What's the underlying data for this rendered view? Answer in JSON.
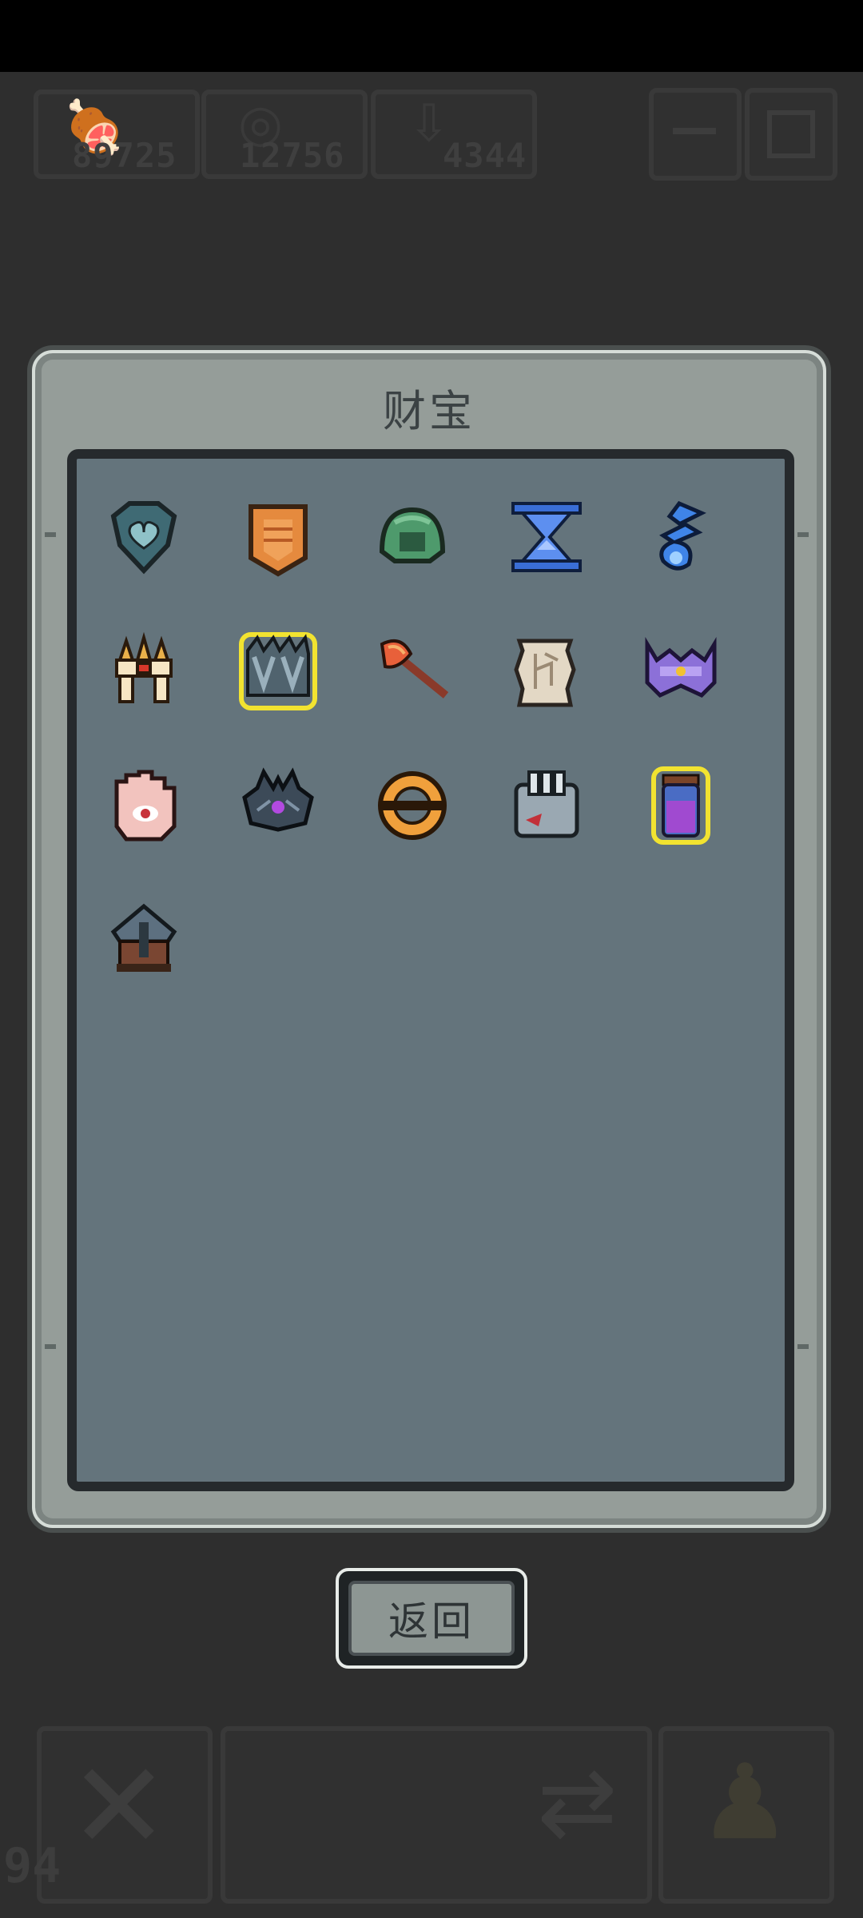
{
  "hud": {
    "resources": [
      {
        "icon": "meat-icon",
        "glyph": "🍖",
        "value": "89725"
      },
      {
        "icon": "ring-icon",
        "glyph": "◎",
        "value": "12756"
      },
      {
        "icon": "arrow-icon",
        "glyph": "⇩",
        "value": "4344"
      }
    ],
    "menu_icon": "menu-icon",
    "settings_icon": "settings-icon",
    "level": "94",
    "bottom_icons": [
      "crossed-swords-icon",
      "swap-icon",
      "character-icon"
    ]
  },
  "dialog": {
    "title": "财宝",
    "back_label": "返回"
  },
  "treasures": [
    {
      "name": "treasure-heart-gem",
      "highlight": false
    },
    {
      "name": "treasure-orange-armor",
      "highlight": false
    },
    {
      "name": "treasure-green-helmet",
      "highlight": false
    },
    {
      "name": "treasure-hourglass",
      "highlight": false
    },
    {
      "name": "treasure-blue-spirit",
      "highlight": false
    },
    {
      "name": "treasure-golden-claws",
      "highlight": false
    },
    {
      "name": "treasure-steel-gauntlets",
      "highlight": true
    },
    {
      "name": "treasure-fire-axe",
      "highlight": false
    },
    {
      "name": "treasure-rune-scroll",
      "highlight": false
    },
    {
      "name": "treasure-purple-crown",
      "highlight": false
    },
    {
      "name": "treasure-eye-palm",
      "highlight": false
    },
    {
      "name": "treasure-dark-crown",
      "highlight": false
    },
    {
      "name": "treasure-golden-ring",
      "highlight": false
    },
    {
      "name": "treasure-stone-fist",
      "highlight": false
    },
    {
      "name": "treasure-purple-potion",
      "highlight": true
    },
    {
      "name": "treasure-iron-helmet",
      "highlight": false
    }
  ]
}
